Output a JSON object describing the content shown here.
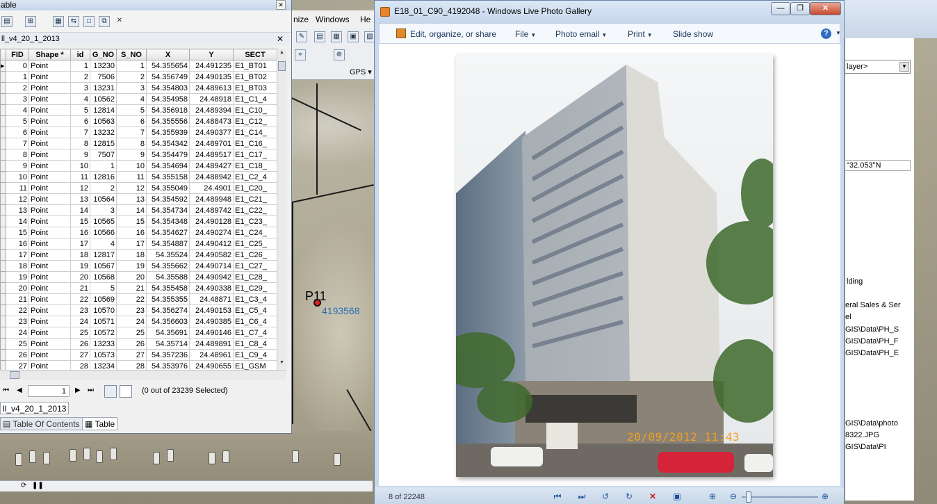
{
  "table_window": {
    "title": "able",
    "tab_name": "ll_v4_20_1_2013",
    "columns": [
      "FID",
      "Shape *",
      "id",
      "G_NO",
      "S_NO",
      "X",
      "Y",
      "SECT"
    ],
    "rows": [
      [
        "0",
        "Point",
        "1",
        "13230",
        "1",
        "54.355654",
        "24.491235",
        "E1_BT01"
      ],
      [
        "1",
        "Point",
        "2",
        "7506",
        "2",
        "54.356749",
        "24.490135",
        "E1_BT02"
      ],
      [
        "2",
        "Point",
        "3",
        "13231",
        "3",
        "54.354803",
        "24.489613",
        "E1_BT03"
      ],
      [
        "3",
        "Point",
        "4",
        "10562",
        "4",
        "54.354958",
        "24.48918",
        "E1_C1_4"
      ],
      [
        "4",
        "Point",
        "5",
        "12814",
        "5",
        "54.356918",
        "24.489394",
        "E1_C10_"
      ],
      [
        "5",
        "Point",
        "6",
        "10563",
        "6",
        "54.355556",
        "24.488473",
        "E1_C12_"
      ],
      [
        "6",
        "Point",
        "7",
        "13232",
        "7",
        "54.355939",
        "24.490377",
        "E1_C14_"
      ],
      [
        "7",
        "Point",
        "8",
        "12815",
        "8",
        "54.354342",
        "24.489701",
        "E1_C16_"
      ],
      [
        "8",
        "Point",
        "9",
        "7507",
        "9",
        "54.354479",
        "24.489517",
        "E1_C17_"
      ],
      [
        "9",
        "Point",
        "10",
        "1",
        "10",
        "54.354694",
        "24.489427",
        "E1_C18_"
      ],
      [
        "10",
        "Point",
        "11",
        "12816",
        "11",
        "54.355158",
        "24.488942",
        "E1_C2_4"
      ],
      [
        "11",
        "Point",
        "12",
        "2",
        "12",
        "54.355049",
        "24.4901",
        "E1_C20_"
      ],
      [
        "12",
        "Point",
        "13",
        "10564",
        "13",
        "54.354592",
        "24.489948",
        "E1_C21_"
      ],
      [
        "13",
        "Point",
        "14",
        "3",
        "14",
        "54.354734",
        "24.489742",
        "E1_C22_"
      ],
      [
        "14",
        "Point",
        "15",
        "10565",
        "15",
        "54.354348",
        "24.490128",
        "E1_C23_"
      ],
      [
        "15",
        "Point",
        "16",
        "10566",
        "16",
        "54.354627",
        "24.490274",
        "E1_C24_"
      ],
      [
        "16",
        "Point",
        "17",
        "4",
        "17",
        "54.354887",
        "24.490412",
        "E1_C25_"
      ],
      [
        "17",
        "Point",
        "18",
        "12817",
        "18",
        "54.35524",
        "24.490582",
        "E1_C26_"
      ],
      [
        "18",
        "Point",
        "19",
        "10567",
        "19",
        "54.355662",
        "24.490714",
        "E1_C27_"
      ],
      [
        "19",
        "Point",
        "20",
        "10568",
        "20",
        "54.35588",
        "24.490942",
        "E1_C28_"
      ],
      [
        "20",
        "Point",
        "21",
        "5",
        "21",
        "54.355458",
        "24.490338",
        "E1_C29_"
      ],
      [
        "21",
        "Point",
        "22",
        "10569",
        "22",
        "54.355355",
        "24.48871",
        "E1_C3_4"
      ],
      [
        "22",
        "Point",
        "23",
        "10570",
        "23",
        "54.356274",
        "24.490153",
        "E1_C5_4"
      ],
      [
        "23",
        "Point",
        "24",
        "10571",
        "24",
        "54.356603",
        "24.490385",
        "E1_C6_4"
      ],
      [
        "24",
        "Point",
        "25",
        "10572",
        "25",
        "54.35691",
        "24.490146",
        "E1_C7_4"
      ],
      [
        "25",
        "Point",
        "26",
        "13233",
        "26",
        "54.35714",
        "24.489891",
        "E1_C8_4"
      ],
      [
        "26",
        "Point",
        "27",
        "10573",
        "27",
        "54.357236",
        "24.48961",
        "E1_C9_4"
      ],
      [
        "27",
        "Point",
        "28",
        "13234",
        "28",
        "54.353976",
        "24.490655",
        "E1_GSM"
      ]
    ],
    "page_number": "1",
    "selection_status": "(0 out of 23239 Selected)",
    "layer_tab": "ll_v4_20_1_2013",
    "bottom_tabs": [
      "Table Of Contents",
      "Table"
    ]
  },
  "arcmap": {
    "menu": [
      "nize",
      "Windows",
      "He"
    ],
    "gps_label": "GPS",
    "map_point_label": "P11",
    "map_point_id": "4193568",
    "right_panel": {
      "combo_value": "layer>",
      "coord_value": "\"32.053\"N",
      "rows": [
        "lding",
        "eral Sales & Ser",
        "el",
        "GIS\\Data\\PH_S",
        "GIS\\Data\\PH_F",
        "GIS\\Data\\PH_E",
        "GIS\\Data\\photo",
        "8322.JPG",
        "GIS\\Data\\PI"
      ]
    }
  },
  "photo_gallery": {
    "title": "E18_01_C90_4192048 - Windows Live Photo Gallery",
    "window_buttons": [
      "minimize",
      "maximize",
      "close"
    ],
    "menu": {
      "edit": "Edit, organize, or share",
      "file": "File",
      "photo_email": "Photo email",
      "print": "Print",
      "slide_show": "Slide show"
    },
    "help": "?",
    "photo_timestamp": "20/09/2012 11:43",
    "status_count": "8 of 22248",
    "zoom_level": 0.05,
    "colors": {
      "accent": "#2f6dc4",
      "close_button": "#c64a2e",
      "timestamp": "#f0a020"
    }
  }
}
